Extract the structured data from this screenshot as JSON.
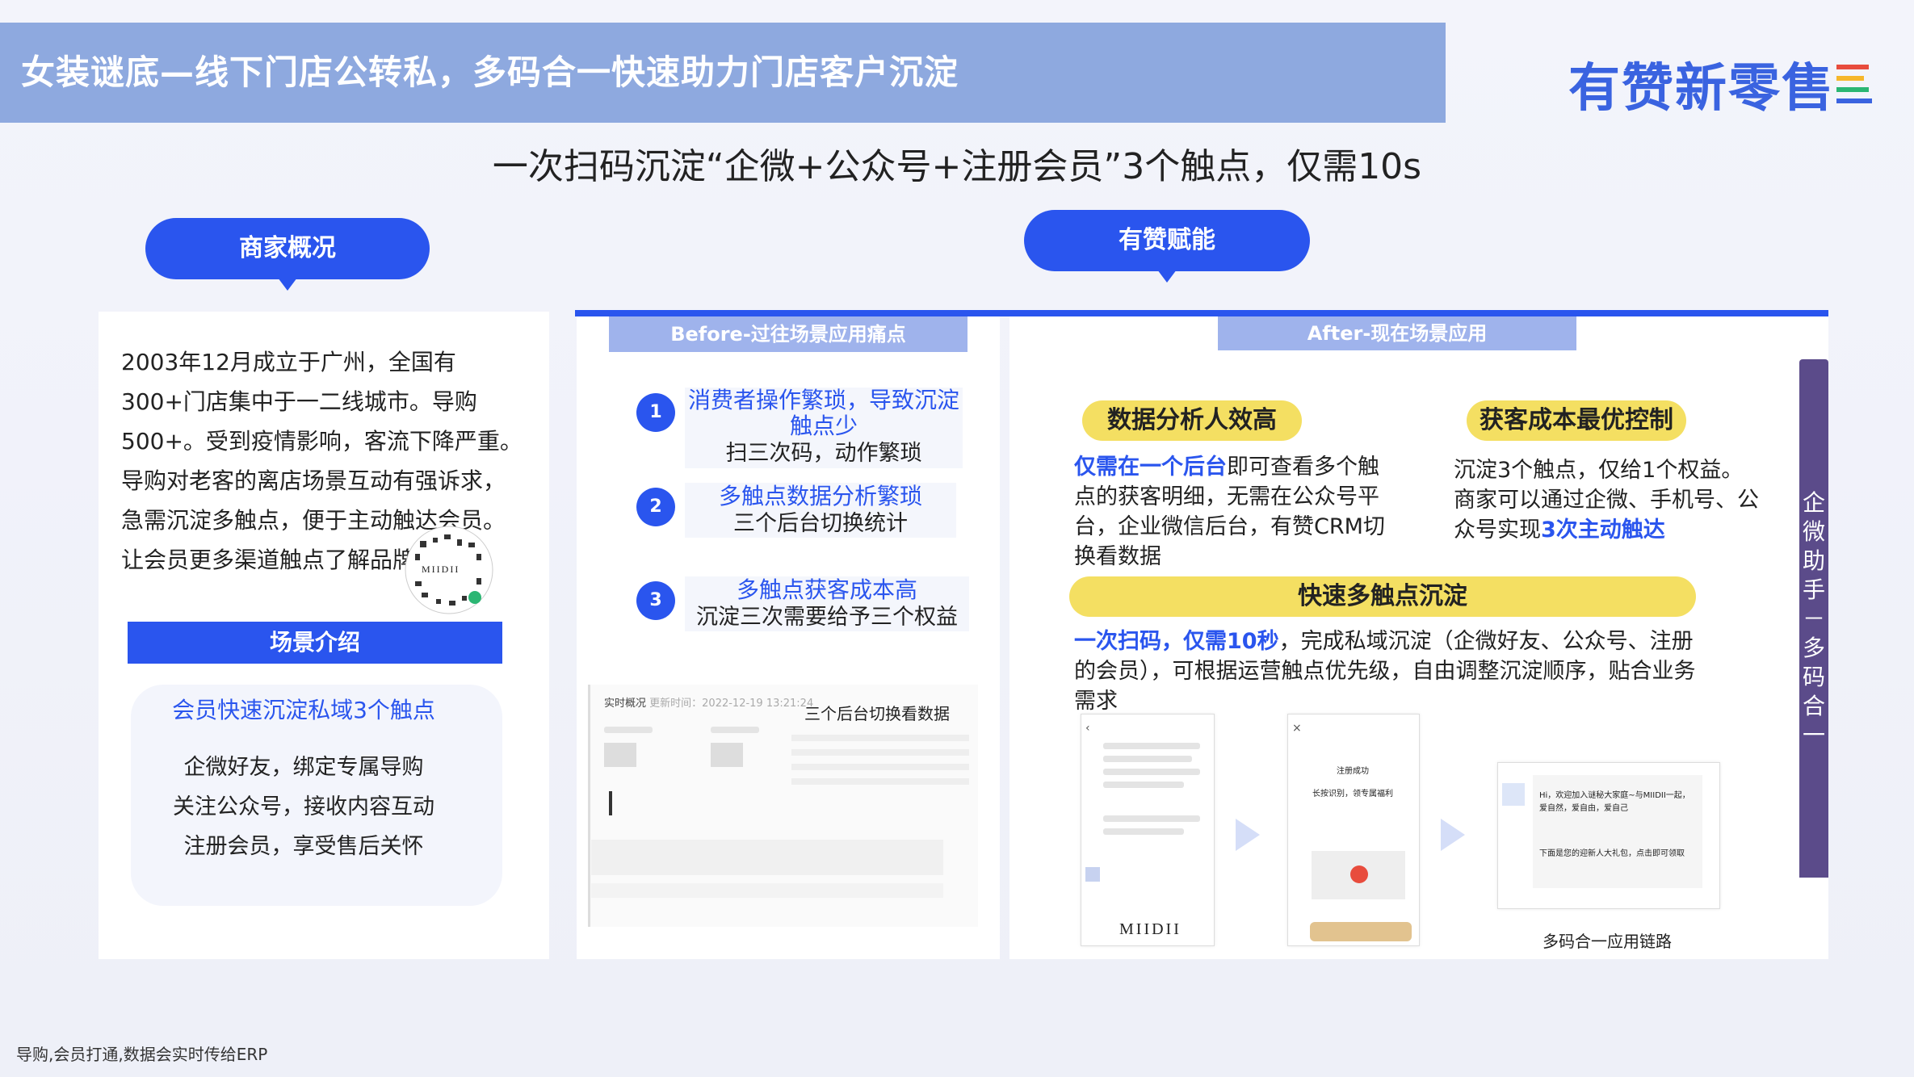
{
  "header": {
    "title": "女装谜底—线下门店公转私，多码合一快速助力门店客户沉淀"
  },
  "logo": {
    "text": "有赞新零售"
  },
  "subtitle": "一次扫码沉淀“企微+公众号+注册会员”3个触点，仅需10s",
  "left": {
    "pill": "商家概况",
    "description": "2003年12月成立于广州，全国有300+门店集中于一二线城市。导购500+。受到疫情影响，客流下降严重。导购对老客的离店场景互动有强诉求，急需沉淀多触点，便于主动触达会员。让会员更多渠道触点了解品牌。",
    "qr_brand": "MIIDII",
    "scene_bar": "场景介绍",
    "scene_title": "会员快速沉淀私域3个触点",
    "scene_items": [
      "企微好友，绑定专属导购",
      "关注公众号，接收内容互动",
      "注册会员，享受售后关怀"
    ]
  },
  "middle": {
    "pill": "有赞赋能",
    "tab": "Before-过往场景应用痛点",
    "items": [
      {
        "num": "1",
        "title": "消费者操作繁琐，导致沉淀触点少",
        "desc": "扫三次码，动作繁琐"
      },
      {
        "num": "2",
        "title": "多触点数据分析繁琐",
        "desc": "三个后台切换统计"
      },
      {
        "num": "3",
        "title": "多触点获客成本高",
        "desc": "沉淀三次需要给予三个权益"
      }
    ],
    "dashboard_title": "实时概况",
    "dashboard_time": "更新时间：2022-12-19 13:21:24",
    "dashboard_caption": "三个后台切换看数据"
  },
  "right": {
    "tab": "After-现在场景应用",
    "box1": {
      "label": "数据分析人效高",
      "highlight": "仅需在一个后台",
      "text": "即可查看多个触点的获客明细，无需在公众号平台，企业微信后台，有赞CRM切换看数据"
    },
    "box2": {
      "label": "获客成本最优控制",
      "text1": "沉淀3个触点，仅给1个权益。商家可以通过企微、手机号、公众号实现",
      "highlight": "3次主动触达"
    },
    "box3": {
      "label": "快速多触点沉淀",
      "highlight": "一次扫码，仅需10秒",
      "text": "，完成私域沉淀（企微好友、公众号、注册的会员），可根据运营触点优先级，自由调整沉淀顺序，贴合业务需求"
    },
    "phone1_brand": "MIIDII",
    "phone2_title": "注册成功",
    "phone2_sub": "长按识别，领专属福利",
    "chat_text": "Hi，欢迎加入谜秘大家庭~与MIIDII一起，爱自然，爱自由，爱自己",
    "chat_text2": "下面是您的迎新人大礼包，点击即可领取",
    "caption": "多码合一应用链路",
    "side_label": "企微助手－多码合一"
  },
  "footer": "导购,会员打通,数据会实时传给ERP",
  "colors": {
    "accent": "#2a55ee",
    "header": "#8ea9df",
    "highlight_yellow": "#f4df62",
    "side_bar": "#5b4b8a"
  }
}
